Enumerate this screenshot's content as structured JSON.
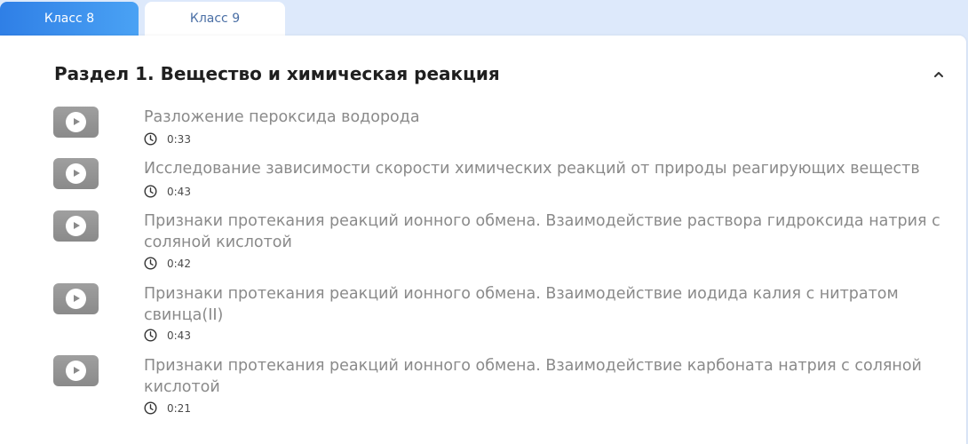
{
  "tabs": [
    {
      "label": "Класс 8",
      "active": true
    },
    {
      "label": "Класс 9",
      "active": false
    }
  ],
  "colors": {
    "accent": "#2f7fe6",
    "background": "#dde9fb",
    "lesson_text": "#8a8a8a",
    "heading": "#1f1f1f"
  },
  "section": {
    "title": "Раздел 1. Вещество и химическая реакция",
    "collapse_icon": "chevron-up-icon",
    "lessons": [
      {
        "title": "Разложение пероксида водорода",
        "duration": "0:33",
        "icon": "play-icon"
      },
      {
        "title": "Исследование зависимости скорости химических реакций от природы реагирующих веществ",
        "duration": "0:43",
        "icon": "play-icon"
      },
      {
        "title": "Признаки протекания реакций ионного обмена. Взаимодействие раствора гидроксида натрия с соляной кислотой",
        "duration": "0:42",
        "icon": "play-icon"
      },
      {
        "title": "Признаки протекания реакций ионного обмена. Взаимодействие иодида калия с нитратом свинца(II)",
        "duration": "0:43",
        "icon": "play-icon"
      },
      {
        "title": "Признаки протекания реакций ионного обмена. Взаимодействие карбоната натрия с соляной кислотой",
        "duration": "0:21",
        "icon": "play-icon"
      }
    ]
  }
}
